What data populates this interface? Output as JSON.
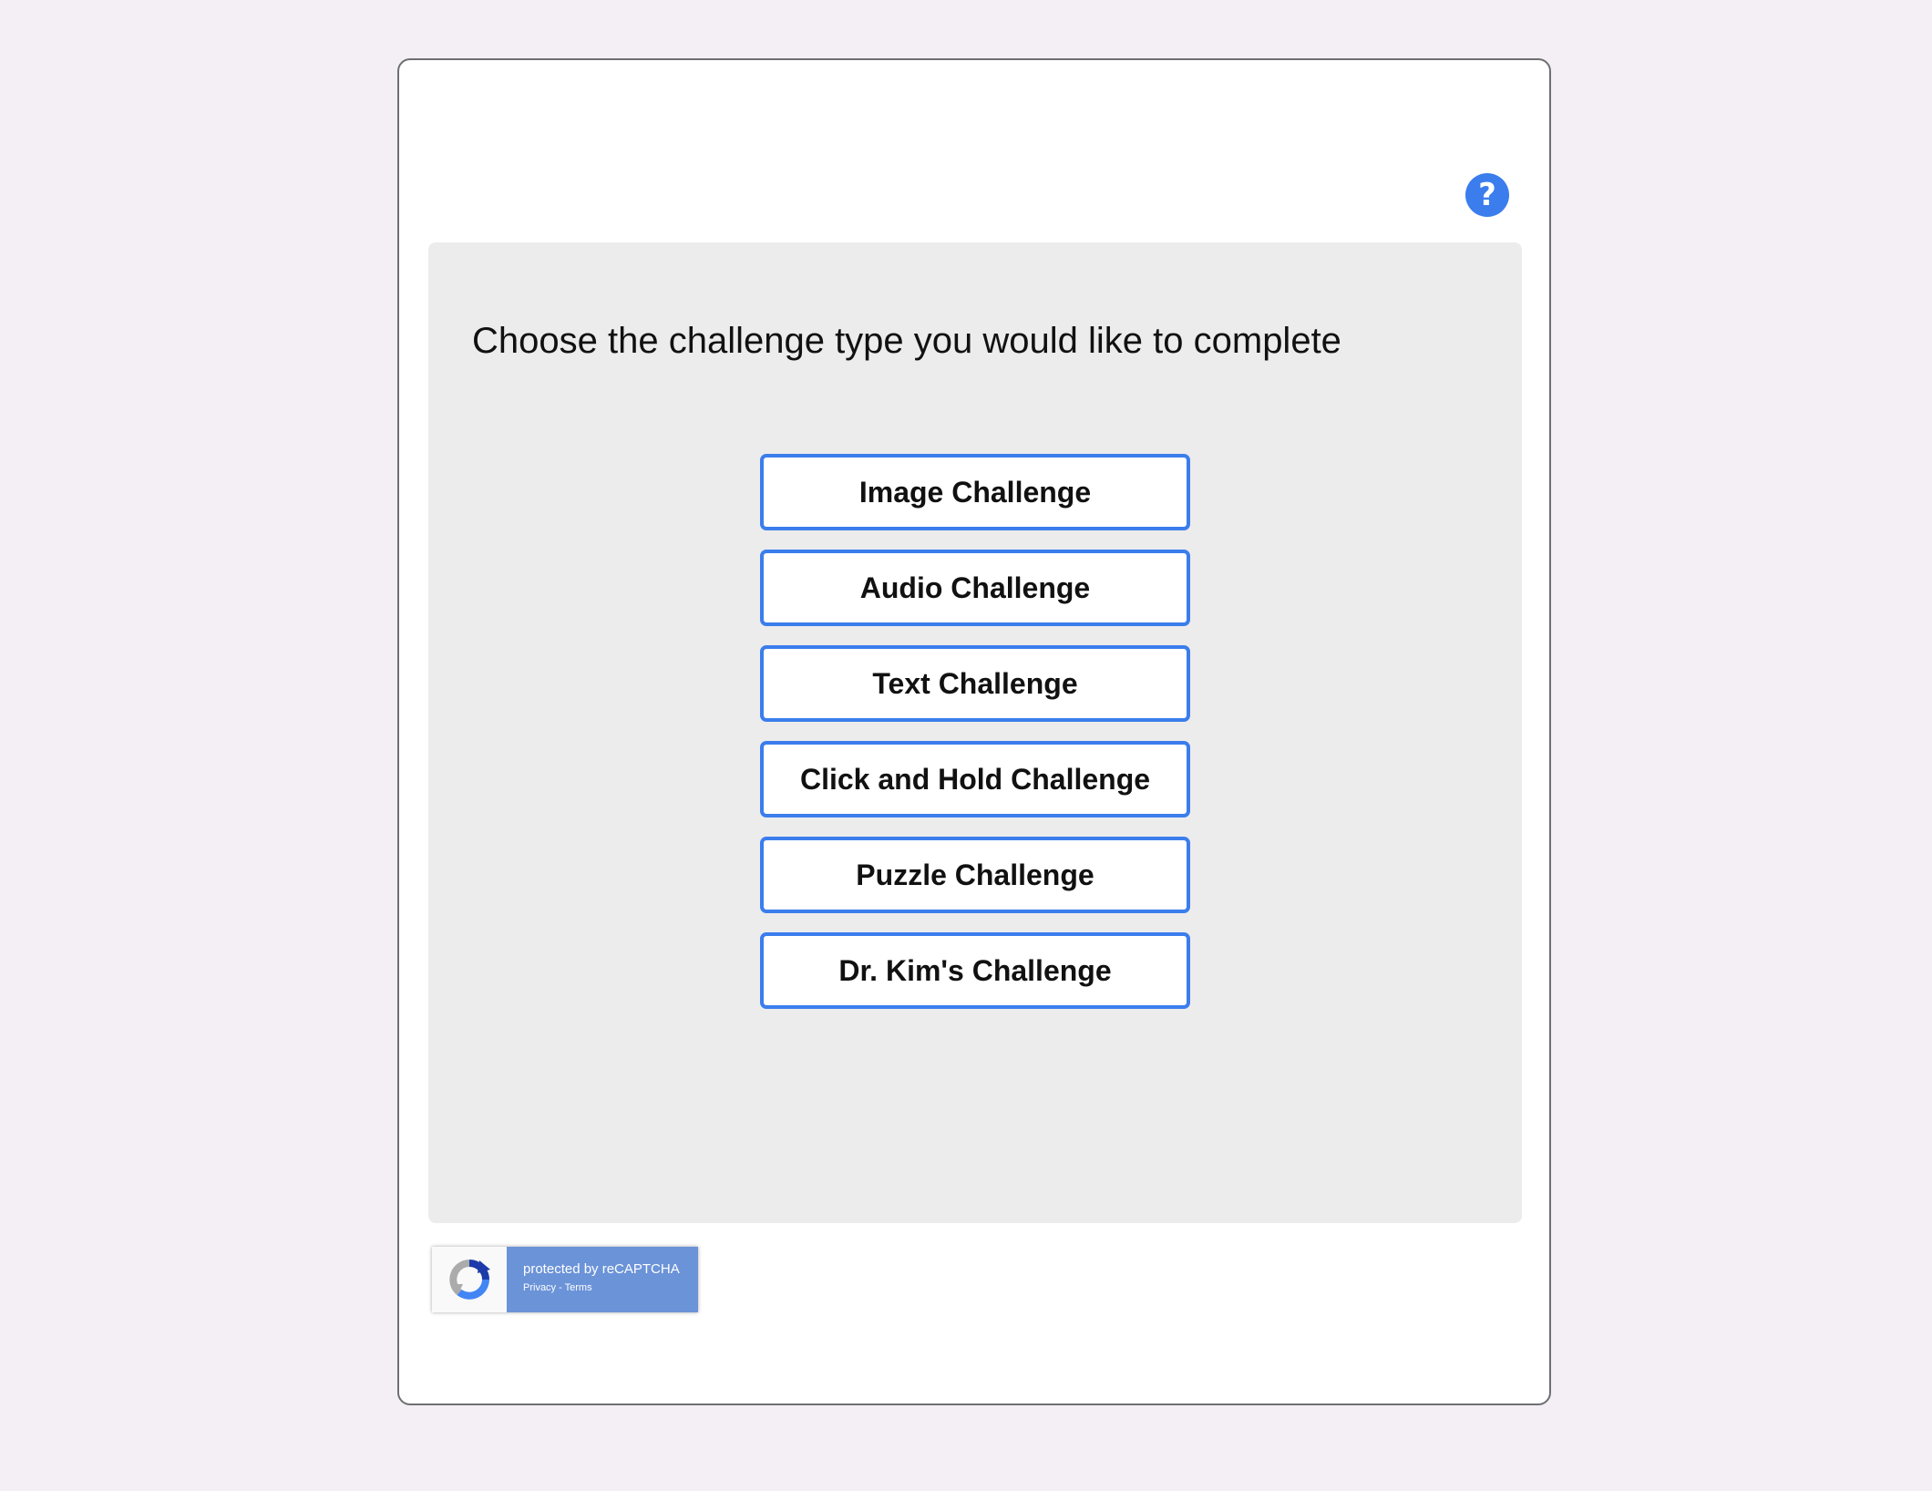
{
  "help": {
    "icon": "question-mark-icon",
    "glyph": "?",
    "color": "#3b7ded"
  },
  "panel": {
    "title": "Choose the challenge type you would like to complete"
  },
  "challenges": [
    {
      "label": "Image Challenge"
    },
    {
      "label": "Audio Challenge"
    },
    {
      "label": "Text Challenge"
    },
    {
      "label": "Click and Hold Challenge"
    },
    {
      "label": "Puzzle Challenge"
    },
    {
      "label": "Dr. Kim's Challenge"
    }
  ],
  "recaptcha": {
    "protected_text": "protected by reCAPTCHA",
    "privacy_label": "Privacy",
    "separator": " - ",
    "terms_label": "Terms",
    "icon": "recaptcha-logo-icon"
  },
  "colors": {
    "accent": "#3b7ded",
    "page_background": "#f3eff5",
    "panel_background": "#ececec",
    "badge_blue": "#6b93d8"
  }
}
